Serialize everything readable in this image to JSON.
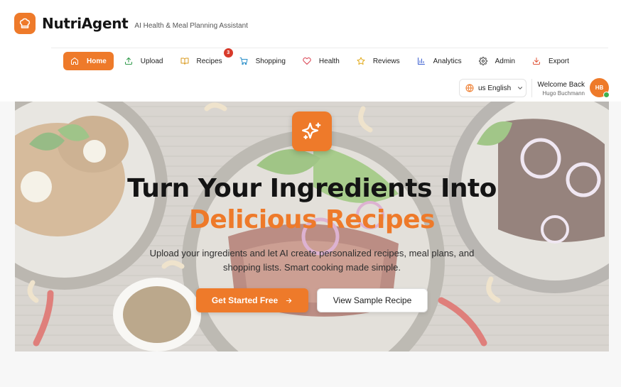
{
  "brand": {
    "name": "NutriAgent",
    "tagline": "AI Health & Meal Planning Assistant",
    "logo_icon": "chef-hat-icon"
  },
  "nav": {
    "items": [
      {
        "label": "Home",
        "icon": "home-icon",
        "active": true
      },
      {
        "label": "Upload",
        "icon": "upload-icon"
      },
      {
        "label": "Recipes",
        "icon": "book-icon",
        "badge": "3"
      },
      {
        "label": "Shopping",
        "icon": "cart-icon"
      },
      {
        "label": "Health",
        "icon": "heart-icon"
      },
      {
        "label": "Reviews",
        "icon": "star-icon"
      },
      {
        "label": "Analytics",
        "icon": "bar-chart-icon"
      },
      {
        "label": "Admin",
        "icon": "gear-icon"
      },
      {
        "label": "Export",
        "icon": "download-icon"
      }
    ]
  },
  "language": {
    "selected": "us English"
  },
  "user": {
    "greeting": "Welcome Back",
    "name": "Hugo Buchmann",
    "initials": "HB",
    "online": true
  },
  "hero": {
    "icon": "sparkles-icon",
    "title_line1": "Turn Your Ingredients Into",
    "title_line2": "Delicious Recipes",
    "subtitle": "Upload your ingredients and let AI create personalized recipes, meal plans, and shopping lists. Smart cooking made simple.",
    "primary_cta": "Get Started Free",
    "secondary_cta": "View Sample Recipe"
  },
  "colors": {
    "accent": "#ee7a2a",
    "badge": "#d83a2a",
    "online": "#3fb04f"
  }
}
